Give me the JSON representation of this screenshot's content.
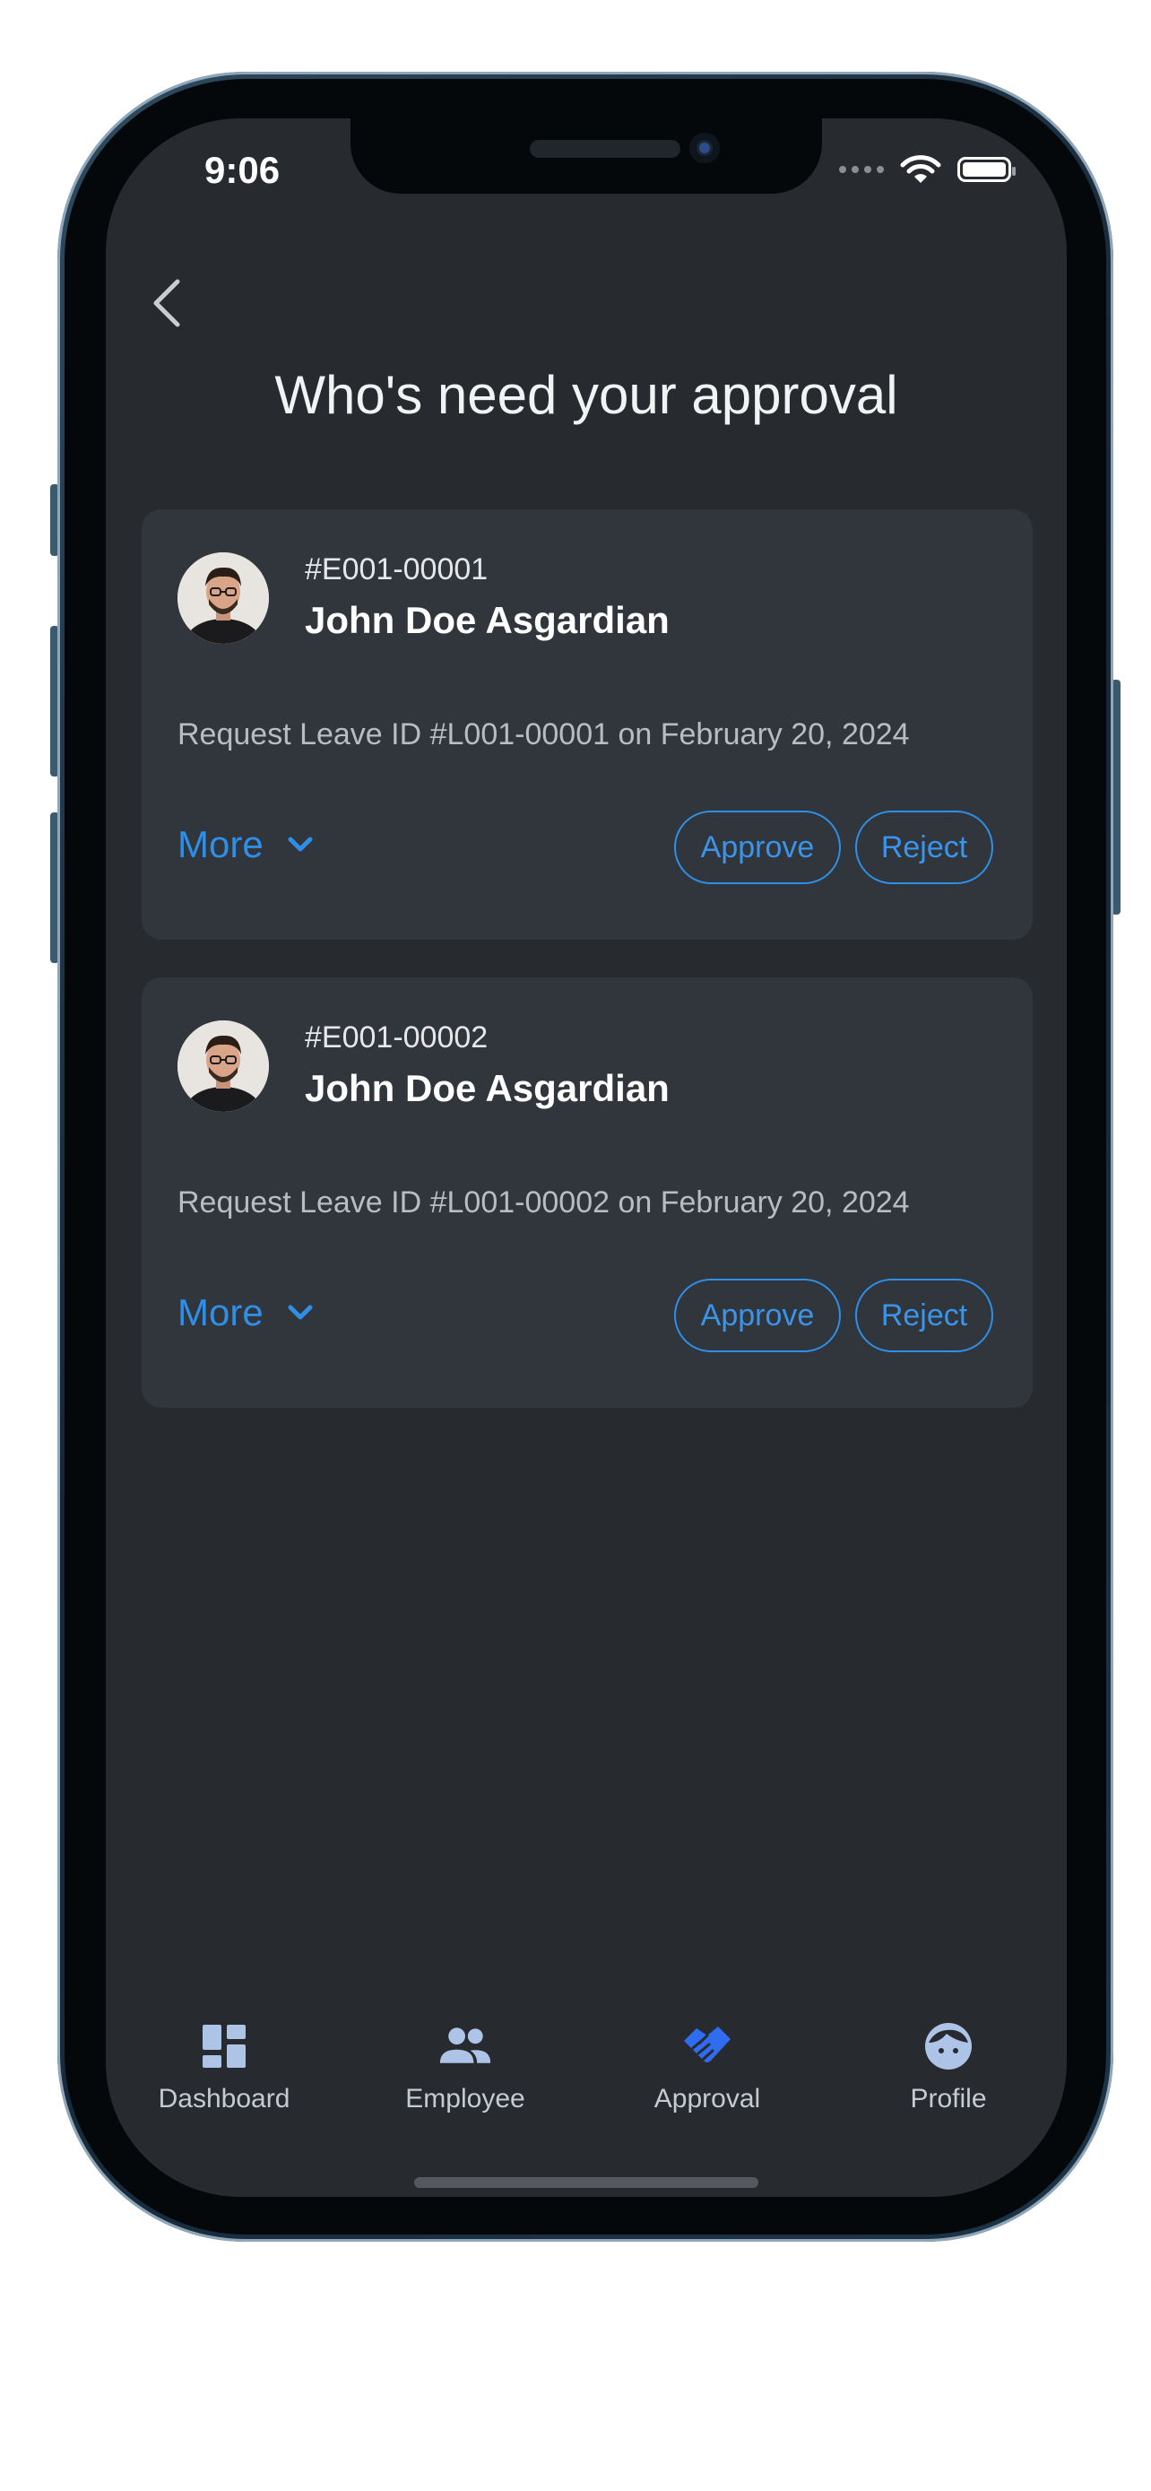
{
  "status_bar": {
    "time": "9:06"
  },
  "header": {
    "title": "Who's need your approval"
  },
  "requests": [
    {
      "employee_id": "#E001-00001",
      "name": "John Doe Asgardian",
      "request_text": "Request Leave ID #L001-00001 on February 20, 2024",
      "more_label": "More",
      "approve_label": "Approve",
      "reject_label": "Reject"
    },
    {
      "employee_id": "#E001-00002",
      "name": "John Doe Asgardian",
      "request_text": "Request Leave ID #L001-00002 on February 20, 2024",
      "more_label": "More",
      "approve_label": "Approve",
      "reject_label": "Reject"
    }
  ],
  "bottom_nav": {
    "items": [
      {
        "label": "Dashboard",
        "icon": "dashboard-icon",
        "active": false
      },
      {
        "label": "Employee",
        "icon": "people-icon",
        "active": false
      },
      {
        "label": "Approval",
        "icon": "handshake-icon",
        "active": true
      },
      {
        "label": "Profile",
        "icon": "face-icon",
        "active": false
      }
    ]
  },
  "colors": {
    "background": "#272a2f",
    "card": "#31353c",
    "accent": "#2f8fe6",
    "active_nav": "#2f6cf0",
    "inactive_nav": "#aec4e6"
  }
}
